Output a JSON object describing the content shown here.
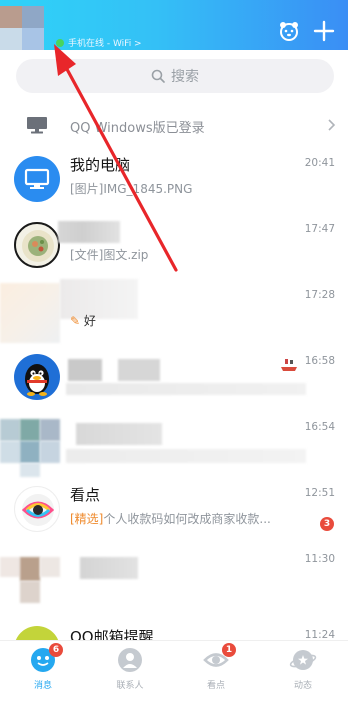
{
  "header": {
    "status_text": "手机在线 - WiFi >",
    "colors": {
      "gradient_start": "#2fd3f8",
      "gradient_end": "#3a8ef5",
      "online_dot": "#48d45f"
    }
  },
  "search": {
    "placeholder": "搜索"
  },
  "pc_banner": {
    "text": "QQ Windows版已登录"
  },
  "chats": [
    {
      "name": "我的电脑",
      "message": "[图片]IMG_1845.PNG",
      "time": "20:41",
      "avatar": "monitor-icon"
    },
    {
      "name": "",
      "message": "[文件]图文.zip",
      "time": "17:47",
      "avatar": "food-photo"
    },
    {
      "name": "",
      "message": "好",
      "time": "17:28",
      "avatar": "blurred"
    },
    {
      "name": "",
      "message": "",
      "time": "16:58",
      "avatar": "qq-penguin"
    },
    {
      "name": "",
      "message": "",
      "time": "16:54",
      "avatar": "blurred"
    },
    {
      "name": "看点",
      "tag": "[精选]",
      "message": "个人收款码如何改成商家收款...",
      "time": "12:51",
      "badge": "3",
      "avatar": "kandian-eye"
    },
    {
      "name": "",
      "message": "",
      "time": "11:30",
      "avatar": "blurred"
    },
    {
      "name": "QQ邮箱提醒",
      "message": "",
      "time": "11:24",
      "avatar": "mail-yellow"
    }
  ],
  "tabbar": {
    "tabs": [
      {
        "label": "消息",
        "badge": "6",
        "active": true
      },
      {
        "label": "联系人"
      },
      {
        "label": "看点",
        "badge": "1"
      },
      {
        "label": "动态"
      }
    ],
    "colors": {
      "active": "#25a8f0",
      "inactive": "#a8aeb5",
      "badge": "#e94b3c"
    }
  }
}
